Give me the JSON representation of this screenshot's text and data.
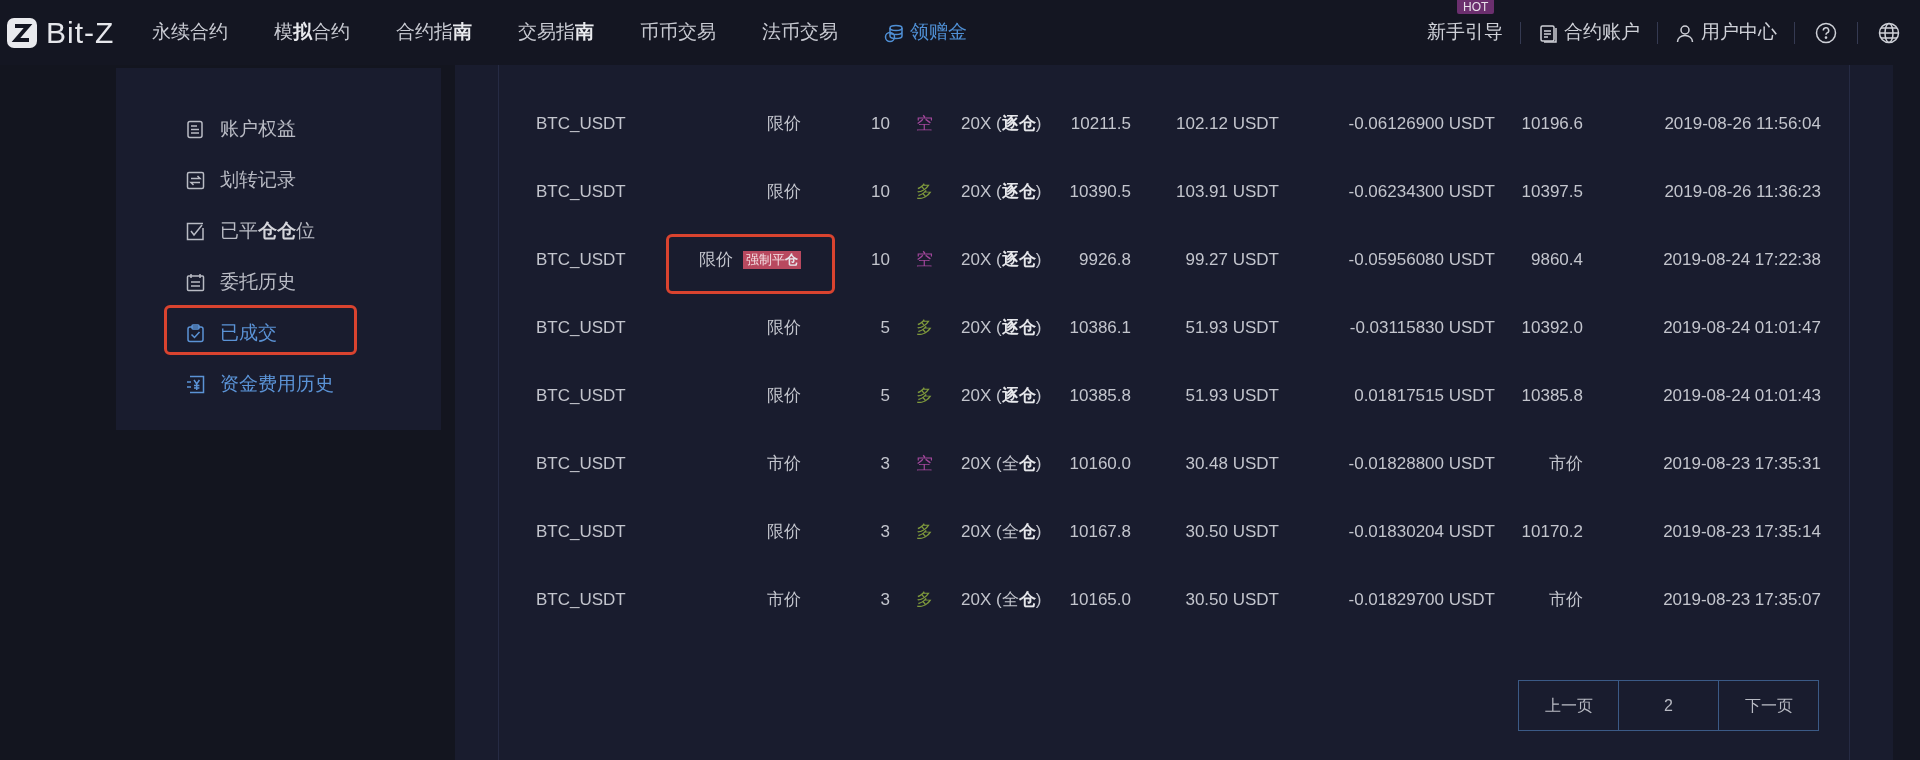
{
  "brand": {
    "name": "Bit-Z"
  },
  "nav": [
    {
      "label": "永续合约",
      "kind": "plain"
    },
    {
      "label": "模**拟**合约",
      "kind": "plain"
    },
    {
      "label": "合约指**南**",
      "kind": "plain"
    },
    {
      "label": "交易指**南**",
      "kind": "plain"
    },
    {
      "label": "币币交易",
      "kind": "plain"
    },
    {
      "label": "法币交易",
      "kind": "plain"
    },
    {
      "label": "领赠金",
      "kind": "promo"
    }
  ],
  "top_right": [
    {
      "label": "新手引导",
      "badge": "HOT",
      "kind": "guide"
    },
    {
      "label": "合约账户",
      "kind": "account"
    },
    {
      "label": "用户中心",
      "kind": "user"
    },
    {
      "kind": "help"
    },
    {
      "kind": "language"
    }
  ],
  "sidebar": {
    "items": [
      {
        "label": "账户权益",
        "kind": "equity",
        "active": false,
        "outlined": false
      },
      {
        "label": "划转记录",
        "kind": "transfer",
        "active": false,
        "outlined": false
      },
      {
        "label": "已平**仓仓**位",
        "kind": "closed",
        "active": false,
        "outlined": false
      },
      {
        "label": "委托历史",
        "kind": "orders",
        "active": false,
        "outlined": false
      },
      {
        "label": "已成交",
        "kind": "filled",
        "active": true,
        "outlined": true
      },
      {
        "label": "资金费用历史",
        "kind": "funding",
        "active": true,
        "outlined": false
      }
    ]
  },
  "table": {
    "rows": [
      {
        "symbol": "BTC_USDT",
        "type": "限价",
        "outlined": false,
        "qty": "10",
        "side": {
          "text": "空",
          "color": "#a2479b"
        },
        "leverage": "20X (**逐仓**)",
        "price": "10211.5",
        "value": "102.12 USDT",
        "fee": "-0.06126900 USDT",
        "close_price": "10196.6",
        "time": "2019-08-26 11:56:04"
      },
      {
        "symbol": "BTC_USDT",
        "type": "限价",
        "outlined": false,
        "qty": "10",
        "side": {
          "text": "多",
          "color": "#7f9a3c"
        },
        "leverage": "20X (**逐仓**)",
        "price": "10390.5",
        "value": "103.91 USDT",
        "fee": "-0.06234300 USDT",
        "close_price": "10397.5",
        "time": "2019-08-26 11:36:23"
      },
      {
        "symbol": "BTC_USDT",
        "type": "限价",
        "tag": "强制平**仓**",
        "outlined": true,
        "qty": "10",
        "side": {
          "text": "空",
          "color": "#a2479b"
        },
        "leverage": "20X (**逐仓**)",
        "price": "9926.8",
        "value": "99.27 USDT",
        "fee": "-0.05956080 USDT",
        "close_price": "9860.4",
        "time": "2019-08-24 17:22:38"
      },
      {
        "symbol": "BTC_USDT",
        "type": "限价",
        "outlined": false,
        "qty": "5",
        "side": {
          "text": "多",
          "color": "#7f9a3c"
        },
        "leverage": "20X (**逐仓**)",
        "price": "10386.1",
        "value": "51.93 USDT",
        "fee": "-0.03115830 USDT",
        "close_price": "10392.0",
        "time": "2019-08-24 01:01:47"
      },
      {
        "symbol": "BTC_USDT",
        "type": "限价",
        "outlined": false,
        "qty": "5",
        "side": {
          "text": "多",
          "color": "#7f9a3c"
        },
        "leverage": "20X (**逐仓**)",
        "price": "10385.8",
        "value": "51.93 USDT",
        "fee": "0.01817515 USDT",
        "close_price": "10385.8",
        "time": "2019-08-24 01:01:43"
      },
      {
        "symbol": "BTC_USDT",
        "type": "市价",
        "outlined": false,
        "qty": "3",
        "side": {
          "text": "空",
          "color": "#a2479b"
        },
        "leverage": "20X (全**仓**)",
        "price": "10160.0",
        "value": "30.48 USDT",
        "fee": "-0.01828800 USDT",
        "close_price": "市价",
        "time": "2019-08-23 17:35:31"
      },
      {
        "symbol": "BTC_USDT",
        "type": "限价",
        "outlined": false,
        "qty": "3",
        "side": {
          "text": "多",
          "color": "#7f9a3c"
        },
        "leverage": "20X (全**仓**)",
        "price": "10167.8",
        "value": "30.50 USDT",
        "fee": "-0.01830204 USDT",
        "close_price": "10170.2",
        "time": "2019-08-23 17:35:14"
      },
      {
        "symbol": "BTC_USDT",
        "type": "市价",
        "outlined": false,
        "qty": "3",
        "side": {
          "text": "多",
          "color": "#7f9a3c"
        },
        "leverage": "20X (全**仓**)",
        "price": "10165.0",
        "value": "30.50 USDT",
        "fee": "-0.01829700 USDT",
        "close_price": "市价",
        "time": "2019-08-23 17:35:07"
      }
    ]
  },
  "pagination": {
    "prev": "上一页",
    "page": "2",
    "next": "下一页"
  }
}
